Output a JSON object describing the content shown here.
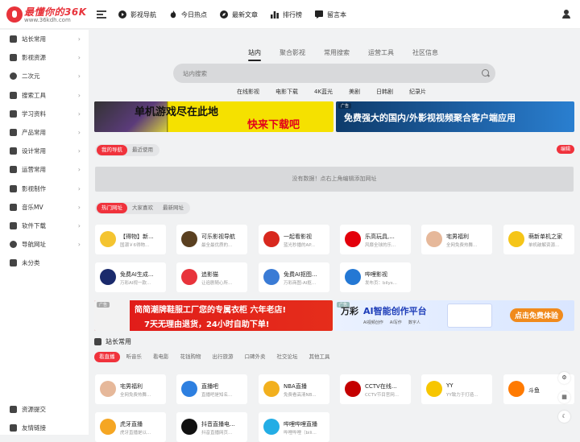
{
  "header": {
    "logo_text": "最懂你的36K",
    "logo_url": "www.36kdh.com",
    "nav": [
      {
        "label": "影视导航",
        "icon": "play-icon"
      },
      {
        "label": "今日热点",
        "icon": "fire-icon"
      },
      {
        "label": "最新文章",
        "icon": "compass-icon"
      },
      {
        "label": "排行榜",
        "icon": "chart-icon"
      },
      {
        "label": "留言本",
        "icon": "message-icon"
      }
    ]
  },
  "sidebar": {
    "items": [
      {
        "label": "站长常用",
        "icon": "cube-icon"
      },
      {
        "label": "影视资源",
        "icon": "film-icon"
      },
      {
        "label": "二次元",
        "icon": "anime-icon"
      },
      {
        "label": "搜索工具",
        "icon": "search-icon"
      },
      {
        "label": "学习资料",
        "icon": "book-icon"
      },
      {
        "label": "产品常用",
        "icon": "monitor-icon"
      },
      {
        "label": "设计常用",
        "icon": "design-icon"
      },
      {
        "label": "运营常用",
        "icon": "layers-icon"
      },
      {
        "label": "影视制作",
        "icon": "video-icon"
      },
      {
        "label": "音乐MV",
        "icon": "music-icon"
      },
      {
        "label": "软件下载",
        "icon": "download-icon"
      },
      {
        "label": "导航网址",
        "icon": "globe-icon"
      },
      {
        "label": "未分类",
        "icon": "stack-icon"
      }
    ],
    "bottom": [
      {
        "label": "资源提交",
        "icon": "send-icon"
      },
      {
        "label": "友情链接",
        "icon": "link-icon"
      }
    ]
  },
  "search": {
    "tabs": [
      "站内",
      "聚合影视",
      "常用搜索",
      "运营工具",
      "社区信息"
    ],
    "placeholder": "站内搜索",
    "quick_links": [
      "在线影视",
      "电影下载",
      "4K蓝光",
      "美剧",
      "日韩剧",
      "纪录片"
    ]
  },
  "banners": {
    "top_left_line1": "单机游戏尽在此地",
    "top_left_line2": "快来下载吧",
    "top_right_tag": "广告",
    "top_right": "免费强大的国内/外影视视频聚合客户端应用",
    "mid_left_tag": "广告",
    "mid_left_line1": "简简潮牌鞋服工厂您的专属衣柜 六年老店!",
    "mid_left_line2": "7天无理由退货，24小时自助下单!",
    "mid_right_tag": "广告",
    "mid_right_brand": "万彩",
    "mid_right": "AI智能创作平台",
    "mid_right_btn": "点击免费体验",
    "mid_right_tags": [
      "AI视频创作",
      "AI写作",
      "数字人"
    ]
  },
  "my_nav": {
    "tabs": [
      "我的导航",
      "最近使用"
    ],
    "edit_label": "编辑",
    "empty_text": "没有数据！点右上角编辑添加网址"
  },
  "hot": {
    "tabs": [
      "热门网址",
      "大家喜欢",
      "最新网址"
    ],
    "row1": [
      {
        "title": "【得物】新...",
        "desc": "国潮￥6得物...",
        "color": "#f4c430"
      },
      {
        "title": "可乐影视导航",
        "desc": "最全最优质的...",
        "color": "#5a4020"
      },
      {
        "title": "一起看影视",
        "desc": "蓝光秒播的AP...",
        "color": "#d8281e"
      },
      {
        "title": "乐高玩具,...",
        "desc": "风靡全球的乐...",
        "color": "#e3000b"
      },
      {
        "title": "宅男福利",
        "desc": "全网免费热舞...",
        "color": "#e6b89a"
      },
      {
        "title": "萌新单机之家",
        "desc": "单机破解资源...",
        "color": "#f5c518"
      }
    ],
    "row2": [
      {
        "title": "免费AI生成...",
        "desc": "万彩AI视一款...",
        "color": "#1a2a6c"
      },
      {
        "title": "追影猫",
        "desc": "让追剧随心所...",
        "color": "#e8333b"
      },
      {
        "title": "免费AI抠图...",
        "desc": "万彩商图-AI抠...",
        "color": "#3a7bd5"
      },
      {
        "title": "哔哩影视",
        "desc": "发布页：bilys...",
        "color": "#2478d4"
      }
    ]
  },
  "section": {
    "title": "站长常用",
    "tabs": [
      "看直播",
      "听音乐",
      "看电影",
      "花钱购物",
      "出行旅游",
      "口碑外卖",
      "社交论坛",
      "其他工具"
    ],
    "row1": [
      {
        "title": "宅男福利",
        "desc": "全网免费热舞...",
        "color": "#e6b89a"
      },
      {
        "title": "直播吧",
        "desc": "直播吧是知名...",
        "color": "#2d7fe0"
      },
      {
        "title": "NBA直播",
        "desc": "免费看高清NB...",
        "color": "#f2b01e"
      },
      {
        "title": "CCTV在线...",
        "desc": "CCTV节目官网...",
        "color": "#c40000"
      },
      {
        "title": "YY",
        "desc": "YY致力于打造...",
        "color": "#f7c600"
      },
      {
        "title": "斗鱼",
        "desc": "",
        "color": "#ff7a00"
      }
    ],
    "row2": [
      {
        "title": "虎牙直播",
        "desc": "虎牙直播是以...",
        "color": "#f5a623"
      },
      {
        "title": "抖音直播电...",
        "desc": "抖音直播网页...",
        "color": "#111111"
      },
      {
        "title": "哔哩哔哩直播",
        "desc": "哔哩哔哩（bili...",
        "color": "#23ade5"
      }
    ]
  }
}
